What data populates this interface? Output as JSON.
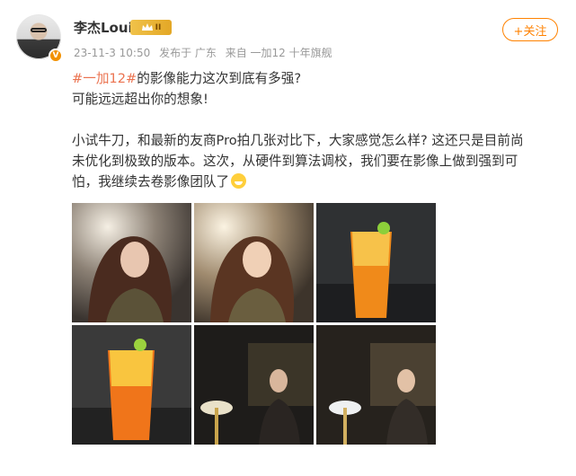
{
  "post": {
    "author": {
      "name": "李杰Louis",
      "member_level": "II",
      "verified_icon": "v-badge-icon"
    },
    "meta": {
      "date": "23-11-3 10:50",
      "location": "发布于 广东",
      "source": "来自 一加12 十年旗舰"
    },
    "follow_label": "+关注",
    "text": {
      "topic": "#一加12#",
      "line1_rest": "的影像能力这次到底有多强?",
      "line2": "可能远远超出你的想象!",
      "para2_l1": "小试牛刀，和最新的友商Pro拍几张对比下，大家感觉怎么样? 这还只是目前尚",
      "para2_l2": "未优化到极致的版本。这次，从硬件到算法调校，我们要在影像上做到强到可",
      "para2_l3": "怕，我继续去卷影像团队了",
      "emoji": "grin-emoji"
    },
    "images": [
      {
        "subject": "woman-portrait-bright"
      },
      {
        "subject": "woman-portrait-warm"
      },
      {
        "subject": "iced-orange-drink"
      },
      {
        "subject": "iced-orange-drink-closeup"
      },
      {
        "subject": "woman-seated-dark-restaurant"
      },
      {
        "subject": "woman-seated-dark-restaurant-bright"
      }
    ]
  }
}
